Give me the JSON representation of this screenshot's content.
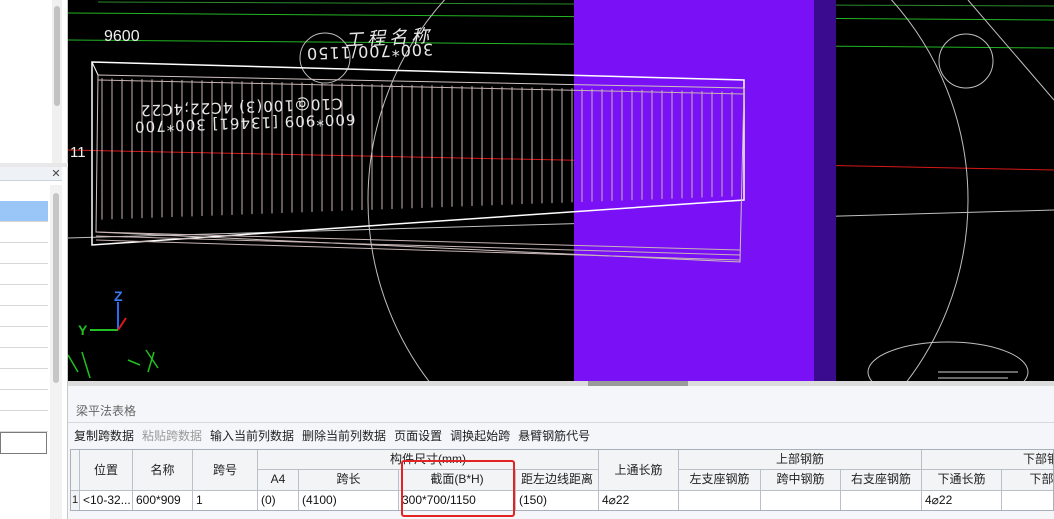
{
  "viewport": {
    "label_9600": "9600",
    "label_11": "11",
    "annotation_project": "工程名称",
    "annotation_mirrored_1": "300*700/1150",
    "annotation_mirrored_2": "C10@100(3) 4C22;4C22",
    "annotation_mirrored_3": "600*909 [13461] 300*700",
    "axis_z": "Z",
    "axis_y": "Y",
    "colors": {
      "background": "#000000",
      "purple_column": "#7a10f5",
      "purple_column_dark": "#3a0a8f",
      "beam_outline": "#ffffff",
      "stirrups": "#c8b4b4",
      "red_axis": "#e01818",
      "green_axis": "#20c020"
    }
  },
  "panel": {
    "title": "梁平法表格",
    "toolbar": [
      "复制跨数据",
      "粘贴跨数据",
      "输入当前列数据",
      "删除当前列数据",
      "页面设置",
      "调换起始跨",
      "悬臂钢筋代号"
    ],
    "toolbar_disabled_index": 1
  },
  "table": {
    "headers": {
      "position": "位置",
      "name": "名称",
      "span_no": "跨号",
      "size_group": "构件尺寸(mm)",
      "a4": "A4",
      "span_len": "跨长",
      "section": "截面(B*H)",
      "offset": "距左边线距离",
      "top_through": "上通长筋",
      "top_group": "上部钢筋",
      "left_seat": "左支座钢筋",
      "mid_span": "跨中钢筋",
      "right_seat": "右支座钢筋",
      "bottom_group": "下部钢筋",
      "bottom_through": "下通长筋",
      "bottom_next": "下部"
    },
    "row": {
      "index": "1",
      "position": "<10-32...",
      "name": "600*909",
      "span_no": "1",
      "a4": "(0)",
      "span_len": "(4100)",
      "section": "300*700/1150",
      "offset": "(150)",
      "top_through": "4⌀22",
      "left_seat": "",
      "mid_span": "",
      "right_seat": "",
      "bottom_through": "4⌀22",
      "bottom_next": ""
    }
  }
}
